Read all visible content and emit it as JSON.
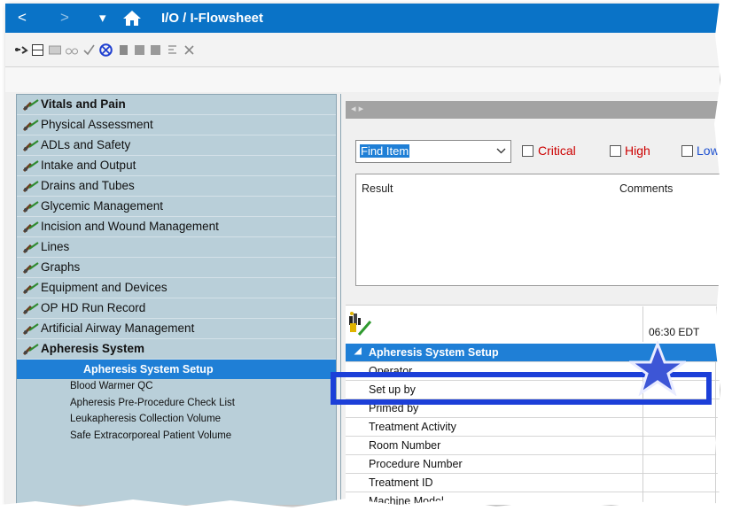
{
  "titlebar": {
    "back_glyph": "<",
    "forward_glyph": ">",
    "menu_glyph": "▾",
    "title": "I/O / I-Flowsheet"
  },
  "left_nav": {
    "sections": [
      {
        "label": "Vitals and Pain",
        "bold": true
      },
      {
        "label": "Physical Assessment"
      },
      {
        "label": "ADLs and Safety"
      },
      {
        "label": "Intake and Output"
      },
      {
        "label": "Drains and Tubes"
      },
      {
        "label": "Glycemic Management"
      },
      {
        "label": "Incision and Wound Management"
      },
      {
        "label": "Lines"
      },
      {
        "label": "Graphs"
      },
      {
        "label": "Equipment and Devices"
      },
      {
        "label": "OP HD Run Record"
      },
      {
        "label": "Artificial Airway Management"
      },
      {
        "label": "Apheresis System",
        "bold": true
      }
    ],
    "subitems": [
      {
        "label": "Apheresis System Setup",
        "selected": true
      },
      {
        "label": "Blood Warmer QC"
      },
      {
        "label": "Apheresis Pre-Procedure Check List"
      },
      {
        "label": "Leukapheresis Collection Volume"
      },
      {
        "label": "Safe Extracorporeal Patient Volume"
      }
    ]
  },
  "filter": {
    "find_item": "Find Item",
    "critical_label": "Critical",
    "high_label": "High",
    "low_label": "Low",
    "critical_color": "#cc0000",
    "high_color": "#cc0000",
    "low_color": "#1c4fd0"
  },
  "results": {
    "col_result": "Result",
    "col_comments": "Comments"
  },
  "grid": {
    "time_column": "06:30 EDT",
    "section_label": "Apheresis System Setup",
    "rows": [
      "Operator",
      "Set up by",
      "Primed by",
      "Treatment Activity",
      "Room Number",
      "Procedure Number",
      "Treatment ID",
      "Machine Model"
    ]
  },
  "colors": {
    "titlebar": "#0a73c7",
    "selection": "#1f7fd6",
    "highlight_box": "#1c3fd8",
    "star": "#3d56d6"
  }
}
